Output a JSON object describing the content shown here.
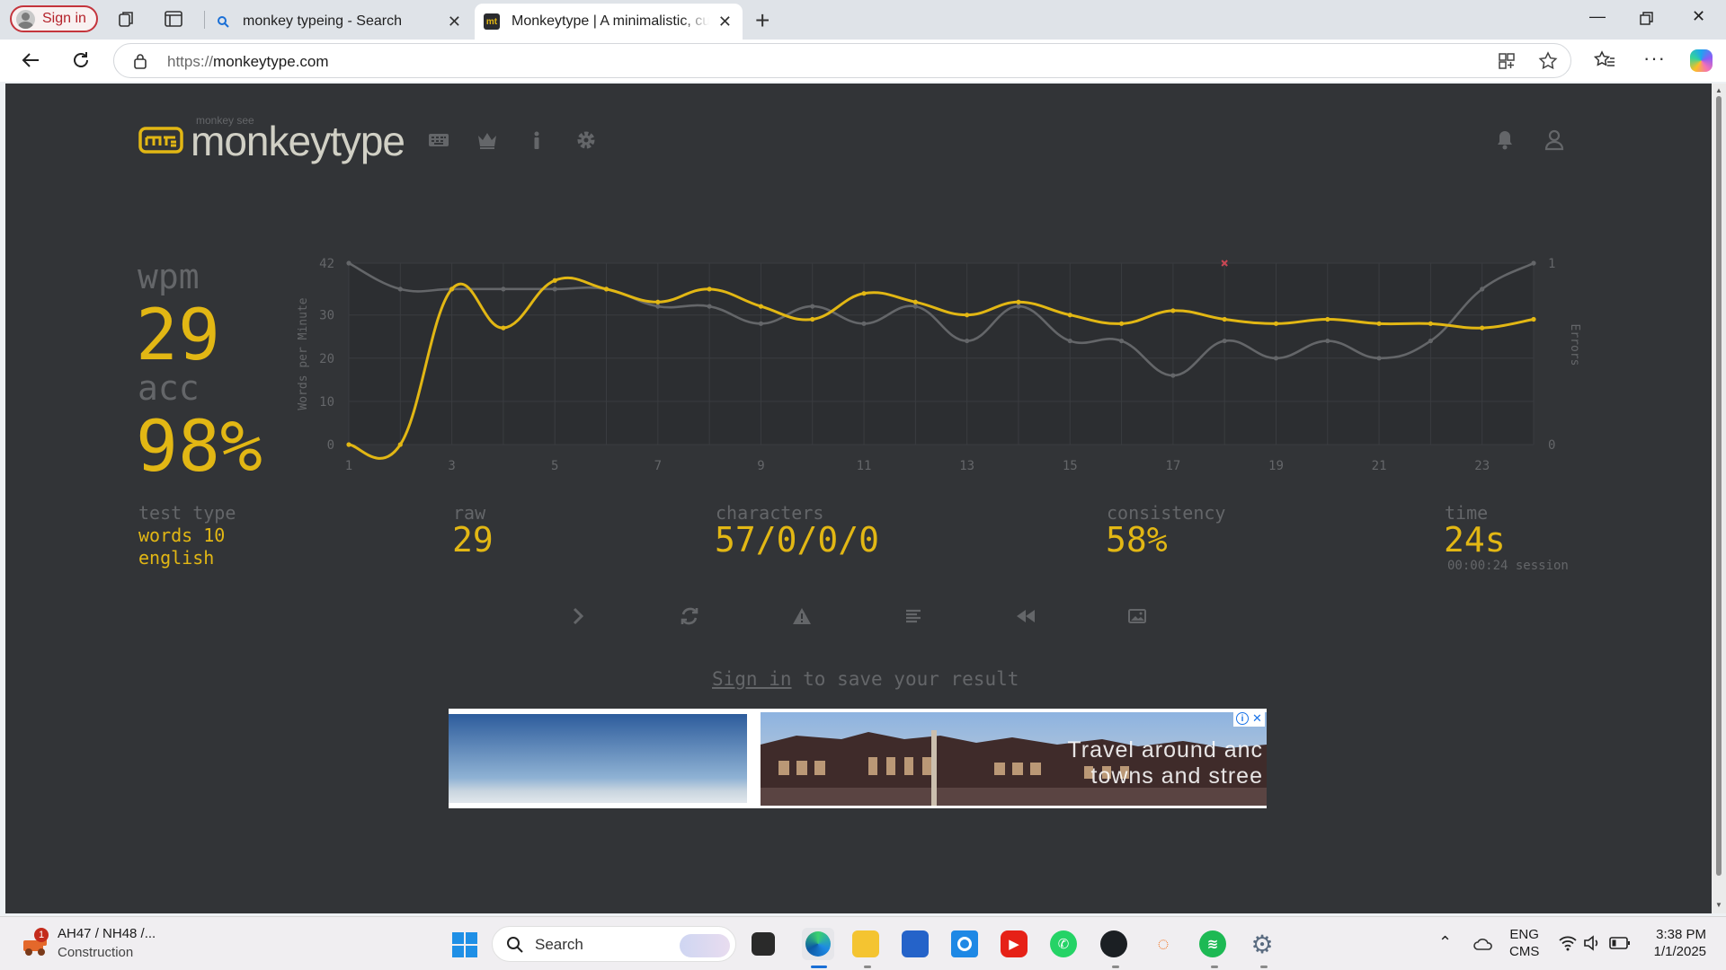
{
  "browser": {
    "signin_label": "Sign in",
    "tabs": [
      {
        "title": "monkey typeing - Search",
        "active": false
      },
      {
        "title": "Monkeytype | A minimalistic, customizable typing test",
        "active": true
      }
    ],
    "favicon_mt": "mt",
    "url_scheme": "https://",
    "url_host": "monkeytype.com"
  },
  "header": {
    "logo_sub": "monkey see",
    "logo": "monkeytype",
    "nav_icons": [
      "keyboard-icon",
      "crown-icon",
      "info-icon",
      "gear-icon"
    ],
    "right_icons": [
      "bell-icon",
      "user-icon"
    ]
  },
  "result": {
    "wpm_label": "wpm",
    "wpm": "29",
    "acc_label": "acc",
    "acc": "98%",
    "test_type_label": "test type",
    "test_mode": "words 10",
    "test_language": "english",
    "raw_label": "raw",
    "raw": "29",
    "characters_label": "characters",
    "characters": "57/0/0/0",
    "consistency_label": "consistency",
    "consistency": "58%",
    "time_label": "time",
    "time": "24s",
    "session": "00:00:24 session"
  },
  "actions": [
    "next-test-icon",
    "restart-icon",
    "report-icon",
    "words-history-icon",
    "replay-icon",
    "screenshot-icon"
  ],
  "signin_note": {
    "link": "Sign in",
    "rest": " to save your result"
  },
  "ad": {
    "text_line1": "Travel around anc",
    "text_line2": "towns and stree"
  },
  "colors": {
    "bg": "#323437",
    "main": "#e2b714",
    "sub": "#646669",
    "text": "#d1d0c5",
    "error": "#ca4754"
  },
  "chart_data": {
    "type": "line",
    "ylabel": "Words per Minute",
    "y2label": "Errors",
    "x": [
      1,
      2,
      3,
      4,
      5,
      6,
      7,
      8,
      9,
      10,
      11,
      12,
      13,
      14,
      15,
      16,
      17,
      18,
      19,
      20,
      21,
      22,
      23,
      24
    ],
    "x_tick_labels": [
      "1",
      "3",
      "5",
      "7",
      "9",
      "11",
      "13",
      "15",
      "17",
      "19",
      "21",
      "23"
    ],
    "y_tick_labels": [
      "0",
      "10",
      "20",
      "30",
      "42"
    ],
    "y2_tick_labels": [
      "0",
      "1"
    ],
    "ylim": [
      0,
      42
    ],
    "y2lim": [
      0,
      1
    ],
    "series": [
      {
        "role": "wpm",
        "color": "#e2b714",
        "values": [
          0,
          0,
          36,
          27,
          38,
          36,
          33,
          36,
          32,
          29,
          35,
          33,
          30,
          33,
          30,
          28,
          31,
          29,
          28,
          29,
          28,
          28,
          27,
          29
        ]
      },
      {
        "role": "raw",
        "color": "#646669",
        "values": [
          42,
          36,
          36,
          36,
          36,
          36,
          32,
          32,
          28,
          32,
          28,
          32,
          24,
          32,
          24,
          24,
          16,
          24,
          20,
          24,
          20,
          24,
          36,
          42
        ]
      },
      {
        "role": "errors",
        "color": "#ca4754",
        "points": [
          {
            "x": 18,
            "y": 1
          }
        ]
      }
    ],
    "grid": true
  },
  "taskbar": {
    "news_title": "AH47 / NH48 /...",
    "news_sub": "Construction",
    "news_badge": "1",
    "search_label": "Search",
    "lang_top": "ENG",
    "lang_bottom": "CMS",
    "clock_time": "3:38 PM",
    "clock_date": "1/1/2025"
  }
}
